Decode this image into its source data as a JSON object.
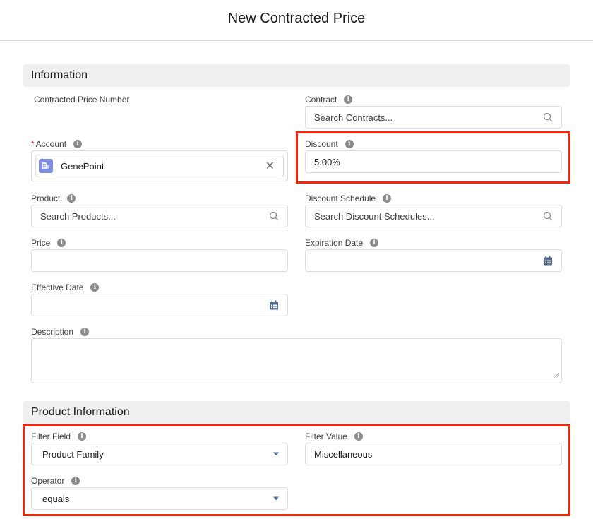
{
  "modal": {
    "title": "New Contracted Price"
  },
  "sections": {
    "information": {
      "title": "Information"
    },
    "product_information": {
      "title": "Product Information"
    }
  },
  "fields": {
    "contracted_price_number": {
      "label": "Contracted Price Number"
    },
    "contract": {
      "label": "Contract",
      "placeholder": "Search Contracts...",
      "icon": "search-icon"
    },
    "account": {
      "label": "Account",
      "required": "*",
      "value": "GenePoint",
      "icon": "account-icon",
      "clear_icon": "close-icon",
      "clear_glyph": "✕"
    },
    "discount": {
      "label": "Discount",
      "value": "5.00%"
    },
    "product": {
      "label": "Product",
      "placeholder": "Search Products...",
      "icon": "search-icon"
    },
    "discount_schedule": {
      "label": "Discount Schedule",
      "placeholder": "Search Discount Schedules...",
      "icon": "search-icon"
    },
    "price": {
      "label": "Price",
      "value": ""
    },
    "expiration_date": {
      "label": "Expiration Date",
      "value": "",
      "icon": "calendar-icon"
    },
    "effective_date": {
      "label": "Effective Date",
      "value": "",
      "icon": "calendar-icon"
    },
    "description": {
      "label": "Description",
      "value": ""
    },
    "filter_field": {
      "label": "Filter Field",
      "value": "Product Family",
      "icon": "chevron-down-icon"
    },
    "filter_value": {
      "label": "Filter Value",
      "value": "Miscellaneous"
    },
    "operator": {
      "label": "Operator",
      "value": "equals",
      "icon": "chevron-down-icon"
    }
  },
  "info_glyph": "i",
  "colors": {
    "highlight": "#f0280c",
    "account_icon": "#7f8de1",
    "required": "#c23934",
    "calendar": "#54698d"
  }
}
